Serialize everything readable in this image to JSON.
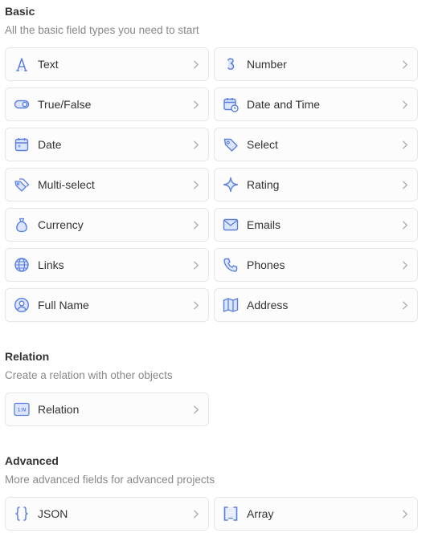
{
  "colors": {
    "icon_stroke": "#5b7fe0",
    "icon_fill": "#dbe5fb",
    "chevron": "#aaaaaa"
  },
  "sections": [
    {
      "id": "basic",
      "title": "Basic",
      "description": "All the basic field types you need to start",
      "items": [
        {
          "label": "Text",
          "icon": "text-icon"
        },
        {
          "label": "Number",
          "icon": "number-icon"
        },
        {
          "label": "True/False",
          "icon": "toggle-icon"
        },
        {
          "label": "Date and Time",
          "icon": "calendar-clock-icon"
        },
        {
          "label": "Date",
          "icon": "calendar-icon"
        },
        {
          "label": "Select",
          "icon": "tag-icon"
        },
        {
          "label": "Multi-select",
          "icon": "tags-icon"
        },
        {
          "label": "Rating",
          "icon": "sparkle-icon"
        },
        {
          "label": "Currency",
          "icon": "money-bag-icon"
        },
        {
          "label": "Emails",
          "icon": "mail-icon"
        },
        {
          "label": "Links",
          "icon": "globe-icon"
        },
        {
          "label": "Phones",
          "icon": "phone-icon"
        },
        {
          "label": "Full Name",
          "icon": "user-circle-icon"
        },
        {
          "label": "Address",
          "icon": "map-icon"
        }
      ]
    },
    {
      "id": "relation",
      "title": "Relation",
      "description": "Create a relation with other objects",
      "items": [
        {
          "label": "Relation",
          "icon": "relation-icon",
          "icon_text": "1:N"
        }
      ]
    },
    {
      "id": "advanced",
      "title": "Advanced",
      "description": "More advanced fields for advanced projects",
      "items": [
        {
          "label": "JSON",
          "icon": "braces-icon"
        },
        {
          "label": "Array",
          "icon": "brackets-icon"
        }
      ]
    }
  ]
}
